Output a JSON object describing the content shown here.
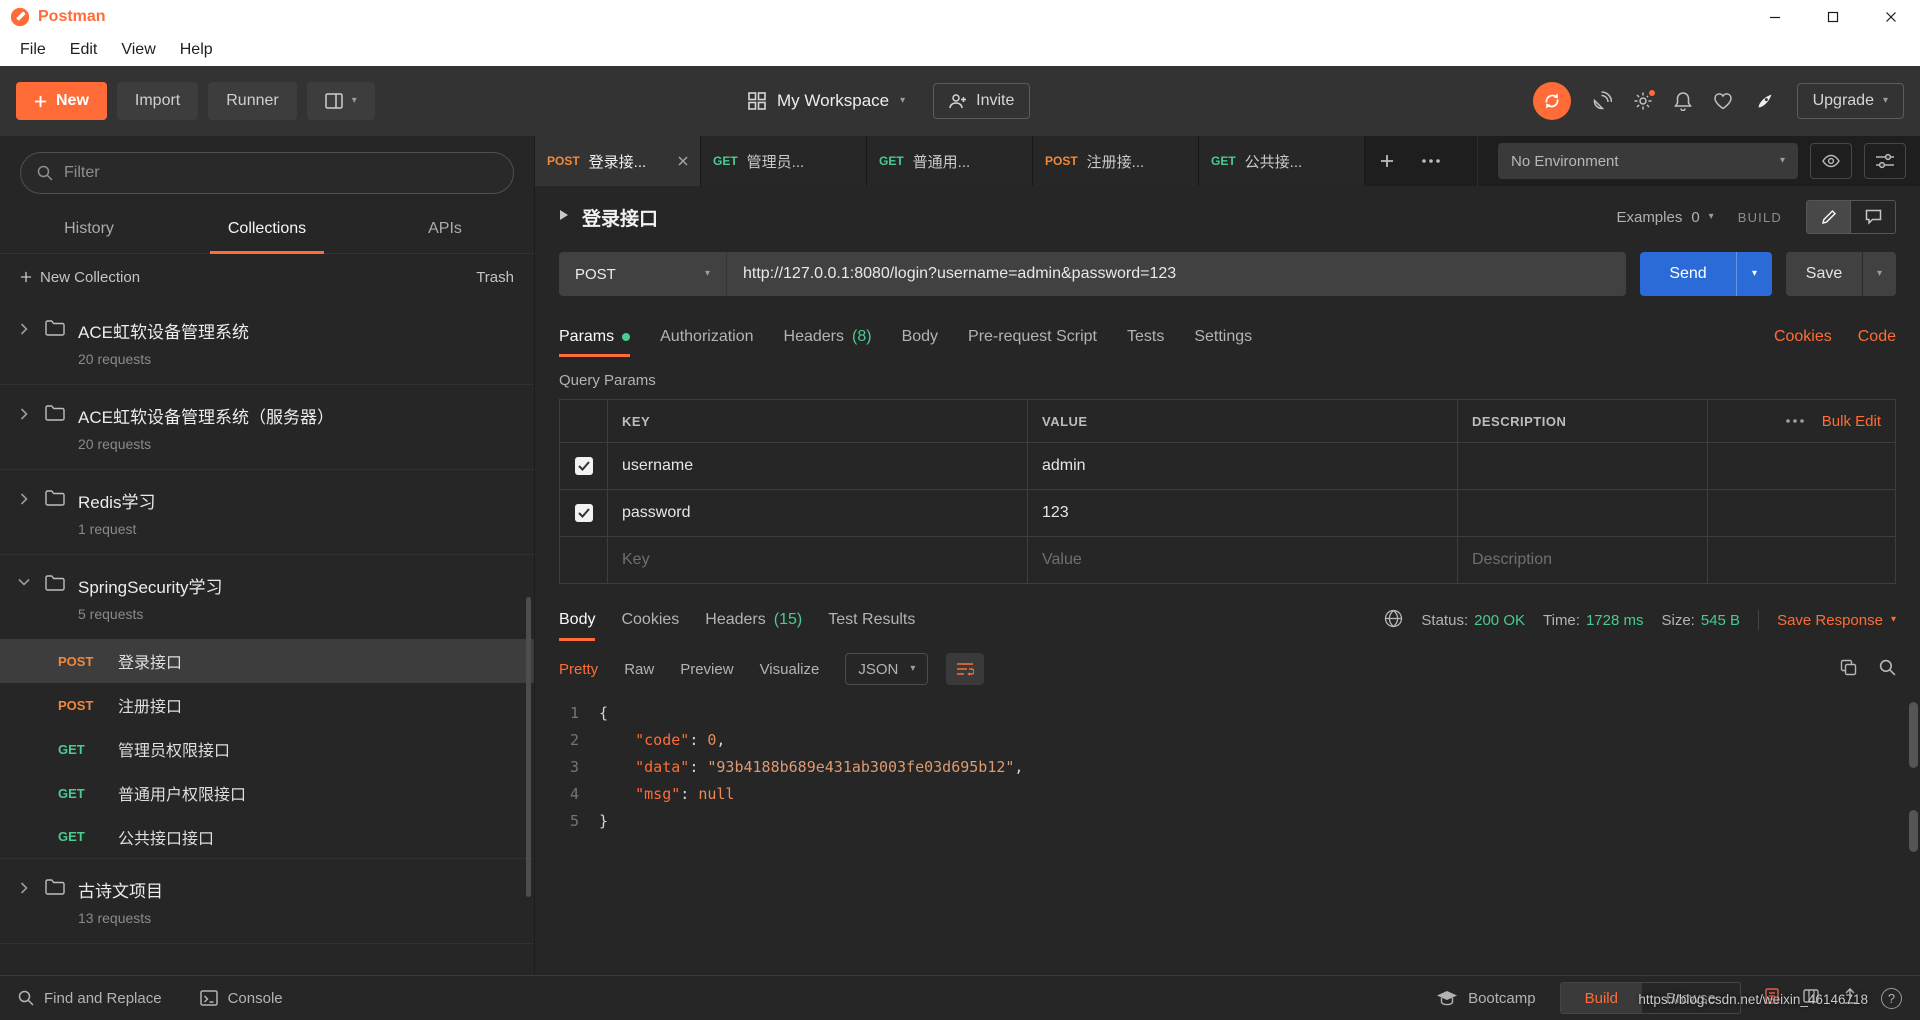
{
  "window": {
    "title": "Postman"
  },
  "menubar": {
    "items": [
      "File",
      "Edit",
      "View",
      "Help"
    ]
  },
  "toolbar": {
    "new": "New",
    "import": "Import",
    "runner": "Runner",
    "workspace": "My Workspace",
    "invite": "Invite",
    "upgrade": "Upgrade"
  },
  "sidebar": {
    "filter_placeholder": "Filter",
    "tabs": {
      "history": "History",
      "collections": "Collections",
      "apis": "APIs"
    },
    "new_collection": "New Collection",
    "trash": "Trash",
    "collections": [
      {
        "name": "ACE虹软设备管理系统",
        "meta": "20 requests"
      },
      {
        "name": "ACE虹软设备管理系统（服务器）",
        "meta": "20 requests"
      },
      {
        "name": "Redis学习",
        "meta": "1 request"
      },
      {
        "name": "SpringSecurity学习",
        "meta": "5 requests"
      },
      {
        "name": "古诗文项目",
        "meta": "13 requests"
      }
    ],
    "requests": [
      {
        "method": "POST",
        "name": "登录接口"
      },
      {
        "method": "POST",
        "name": "注册接口"
      },
      {
        "method": "GET",
        "name": "管理员权限接口"
      },
      {
        "method": "GET",
        "name": "普通用户权限接口"
      },
      {
        "method": "GET",
        "name": "公共接口接口"
      }
    ]
  },
  "tabstrip": {
    "tabs": [
      {
        "method": "POST",
        "label": "登录接..."
      },
      {
        "method": "GET",
        "label": "管理员..."
      },
      {
        "method": "GET",
        "label": "普通用..."
      },
      {
        "method": "POST",
        "label": "注册接..."
      },
      {
        "method": "GET",
        "label": "公共接..."
      }
    ],
    "environment": "No Environment"
  },
  "request": {
    "title": "登录接口",
    "examples": "Examples",
    "examples_count": "0",
    "build": "BUILD",
    "method": "POST",
    "url": "http://127.0.0.1:8080/login?username=admin&password=123",
    "send": "Send",
    "save": "Save",
    "tabs": {
      "params": "Params",
      "authorization": "Authorization",
      "headers": "Headers",
      "headers_count": "(8)",
      "body": "Body",
      "prerequest": "Pre-request Script",
      "tests": "Tests",
      "settings": "Settings"
    },
    "cookies": "Cookies",
    "code": "Code",
    "query_params": "Query Params"
  },
  "params_table": {
    "headers": {
      "key": "KEY",
      "value": "VALUE",
      "description": "DESCRIPTION"
    },
    "bulk_edit": "Bulk Edit",
    "rows": [
      {
        "key": "username",
        "value": "admin"
      },
      {
        "key": "password",
        "value": "123"
      }
    ],
    "placeholders": {
      "key": "Key",
      "value": "Value",
      "description": "Description"
    }
  },
  "response": {
    "tabs": {
      "body": "Body",
      "cookies": "Cookies",
      "headers": "Headers",
      "headers_count": "(15)",
      "tests": "Test Results"
    },
    "status_label": "Status:",
    "status": "200 OK",
    "time_label": "Time:",
    "time": "1728 ms",
    "size_label": "Size:",
    "size": "545 B",
    "save_response": "Save Response",
    "views": {
      "pretty": "Pretty",
      "raw": "Raw",
      "preview": "Preview",
      "visualize": "Visualize"
    },
    "format": "JSON",
    "body": {
      "line_numbers": [
        "1",
        "2",
        "3",
        "4",
        "5"
      ],
      "open_brace": "{",
      "close_brace": "}",
      "indent": "    ",
      "entries": [
        {
          "key": "\"code\"",
          "colon": ": ",
          "value": "0",
          "comma": ","
        },
        {
          "key": "\"data\"",
          "colon": ": ",
          "value": "\"93b4188b689e431ab3003fe03d695b12\"",
          "comma": ","
        },
        {
          "key": "\"msg\"",
          "colon": ": ",
          "value": "null",
          "comma": ""
        }
      ]
    }
  },
  "statusbar": {
    "find_replace": "Find and Replace",
    "console": "Console",
    "bootcamp": "Bootcamp",
    "build": "Build",
    "browse": "Browse",
    "help": "?"
  },
  "watermark": "https://blog.csdn.net/weixin_46146718",
  "colors": {
    "accent": "#ff6c37",
    "get": "#49cc90",
    "post": "#f0883e",
    "green": "#49cc90",
    "send_blue": "#2a6bd8"
  }
}
